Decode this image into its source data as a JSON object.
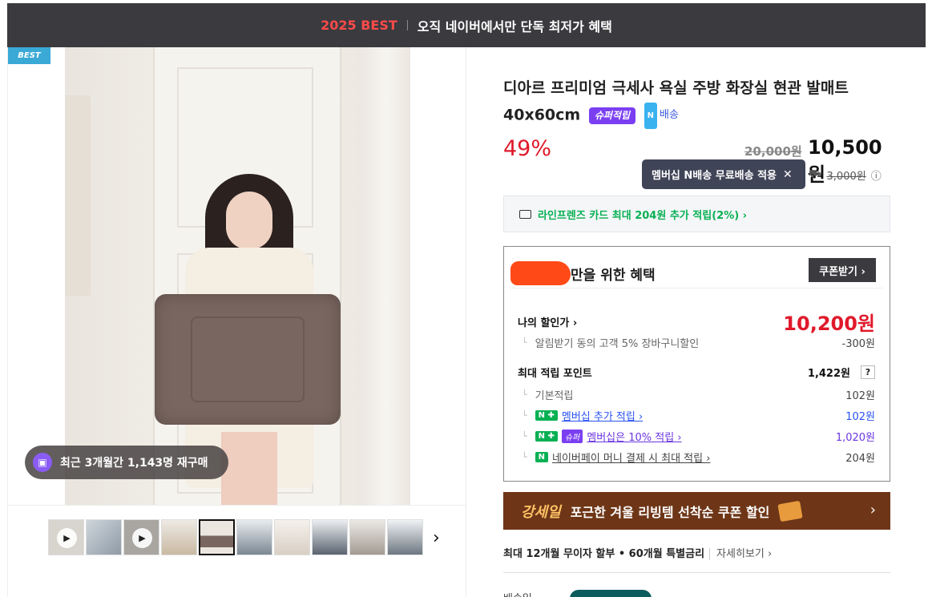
{
  "topbar": {
    "best": "2025 BEST",
    "promo": "오직 네이버에서만 단독 최저가 혜택"
  },
  "gallery": {
    "best_tag": "BEST",
    "repurchase": "최근 3개월간 1,143명 재구매",
    "thumbnail_count": 10,
    "selected_thumbnail": 5,
    "next_arrow": "›"
  },
  "product": {
    "title": "디아르 프리미엄 극세사 욕실 주방 화장실 현관 발매트 40x60cm",
    "super_badge": "슈퍼적립",
    "delivery_badge": "배송",
    "n_mark": "N",
    "discount": "49%",
    "original_price": "20,000원",
    "price": "10,500원"
  },
  "shipping": {
    "tooltip": "멤버십 N배송 무료배송 적용",
    "close": "✕",
    "old_fee": "3,000원",
    "info": "ⓘ"
  },
  "card_promo": "라인프렌즈 카드 최대 204원 추가 적립(2%) ›",
  "benefit": {
    "title": "만을 위한 혜택",
    "coupon_button": "쿠폰받기 ›",
    "my_price_label": "나의 할인가 ›",
    "my_price": "10,200원",
    "alarm_label": "알림받기 동의 고객 5% 장바구니할인",
    "alarm_value": "-300원",
    "max_points_label": "최대 적립 포인트",
    "max_points": "1,422원",
    "help": "?",
    "basic_label": "기본적립",
    "basic_value": "102원",
    "member_label": "멤버십 추가 적립 ›",
    "member_value": "102원",
    "super_label": "멤버십은 10% 적립 ›",
    "super_value": "1,020원",
    "pay_label": "네이버페이 머니 결제 시 최대 적립 ›",
    "pay_value": "204원",
    "n_plus": "N ✚",
    "super_badge": "슈퍼",
    "pay_badge": "N"
  },
  "banner": {
    "brand": "강세일",
    "text": "포근한 겨울 리빙템 선착순 쿠폰 할인",
    "arrow": "›"
  },
  "install": {
    "text": "최대 12개월 무이자 할부 • 60개월 특별금리",
    "more": "자세히보기 ›"
  },
  "delivery": {
    "label": "배송일"
  }
}
